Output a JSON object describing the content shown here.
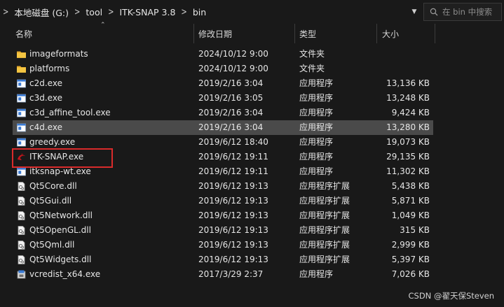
{
  "address": {
    "crumbs": [
      "本地磁盘 (G:)",
      "tool",
      "ITK-SNAP 3.8",
      "bin"
    ],
    "search_placeholder": "在 bin 中搜索"
  },
  "columns": {
    "name": "名称",
    "date": "修改日期",
    "type": "类型",
    "size": "大小"
  },
  "files": [
    {
      "name": "imageformats",
      "date": "2024/10/12 9:00",
      "type": "文件夹",
      "size": "",
      "icon": "folder-icon"
    },
    {
      "name": "platforms",
      "date": "2024/10/12 9:00",
      "type": "文件夹",
      "size": "",
      "icon": "folder-icon"
    },
    {
      "name": "c2d.exe",
      "date": "2019/2/16 3:04",
      "type": "应用程序",
      "size": "13,136 KB",
      "icon": "exe-icon"
    },
    {
      "name": "c3d.exe",
      "date": "2019/2/16 3:05",
      "type": "应用程序",
      "size": "13,248 KB",
      "icon": "exe-icon"
    },
    {
      "name": "c3d_affine_tool.exe",
      "date": "2019/2/16 3:04",
      "type": "应用程序",
      "size": "9,424 KB",
      "icon": "exe-icon"
    },
    {
      "name": "c4d.exe",
      "date": "2019/2/16 3:04",
      "type": "应用程序",
      "size": "13,280 KB",
      "icon": "exe-icon",
      "selected": true
    },
    {
      "name": "greedy.exe",
      "date": "2019/6/12 18:40",
      "type": "应用程序",
      "size": "19,073 KB",
      "icon": "exe-icon"
    },
    {
      "name": "ITK-SNAP.exe",
      "date": "2019/6/12 19:11",
      "type": "应用程序",
      "size": "29,135 KB",
      "icon": "itksnap-icon"
    },
    {
      "name": "itksnap-wt.exe",
      "date": "2019/6/12 19:11",
      "type": "应用程序",
      "size": "11,302 KB",
      "icon": "exe-icon"
    },
    {
      "name": "Qt5Core.dll",
      "date": "2019/6/12 19:13",
      "type": "应用程序扩展",
      "size": "5,438 KB",
      "icon": "dll-icon"
    },
    {
      "name": "Qt5Gui.dll",
      "date": "2019/6/12 19:13",
      "type": "应用程序扩展",
      "size": "5,871 KB",
      "icon": "dll-icon"
    },
    {
      "name": "Qt5Network.dll",
      "date": "2019/6/12 19:13",
      "type": "应用程序扩展",
      "size": "1,049 KB",
      "icon": "dll-icon"
    },
    {
      "name": "Qt5OpenGL.dll",
      "date": "2019/6/12 19:13",
      "type": "应用程序扩展",
      "size": "315 KB",
      "icon": "dll-icon"
    },
    {
      "name": "Qt5Qml.dll",
      "date": "2019/6/12 19:13",
      "type": "应用程序扩展",
      "size": "2,999 KB",
      "icon": "dll-icon"
    },
    {
      "name": "Qt5Widgets.dll",
      "date": "2019/6/12 19:13",
      "type": "应用程序扩展",
      "size": "5,397 KB",
      "icon": "dll-icon"
    },
    {
      "name": "vcredist_x64.exe",
      "date": "2017/3/29 2:37",
      "type": "应用程序",
      "size": "7,026 KB",
      "icon": "installer-icon"
    }
  ],
  "watermark": "CSDN @翟天保Steven",
  "colors": {
    "background": "#191919",
    "selected_row": "#4a4a4a",
    "highlight_border": "#d92b2b",
    "folder": "#f4c542",
    "exe_blue": "#3b7bd4"
  }
}
